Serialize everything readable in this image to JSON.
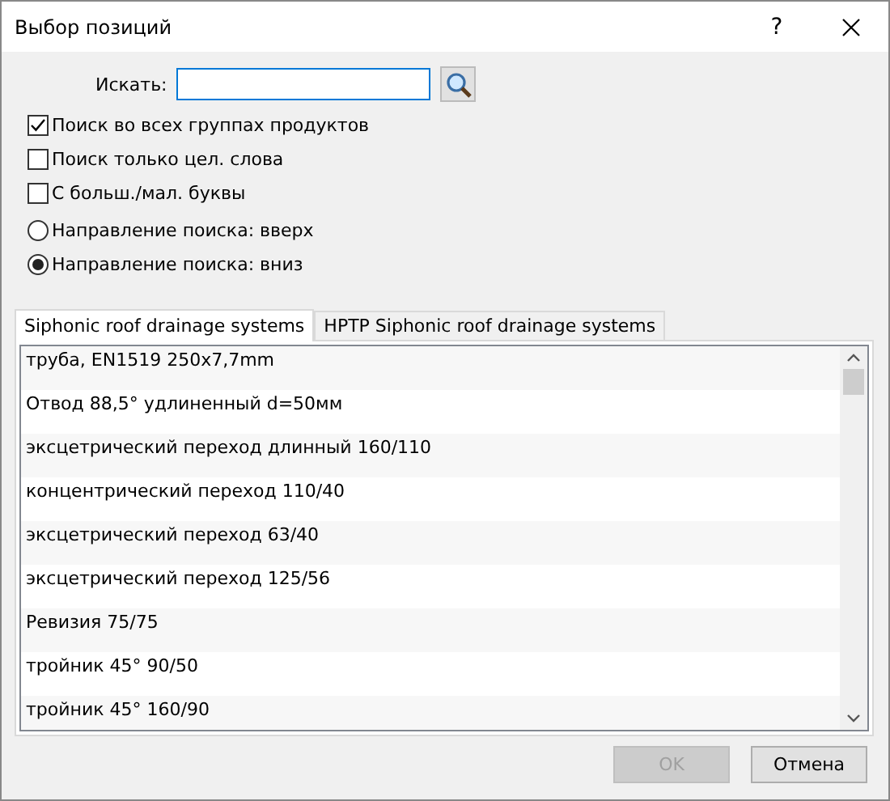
{
  "window": {
    "title": "Выбор позиций",
    "help": "?"
  },
  "search": {
    "label": "Искать:"
  },
  "options": [
    {
      "kind": "checkbox",
      "label": "Поиск во всех группах продуктов",
      "checked": true
    },
    {
      "kind": "checkbox",
      "label": "Поиск только цел. слова",
      "checked": false
    },
    {
      "kind": "checkbox",
      "label": "С больш./мал. буквы",
      "checked": false
    },
    {
      "kind": "radio",
      "label": "Направление поиска: вверх",
      "selected": false
    },
    {
      "kind": "radio",
      "label": "Направление поиска: вниз",
      "selected": true
    }
  ],
  "tabs": [
    {
      "label": "Siphonic roof drainage systems",
      "selected": true
    },
    {
      "label": "HPTP Siphonic roof drainage systems",
      "selected": false
    }
  ],
  "items": [
    "труба, EN1519 250x7,7mm",
    "Отвод 88,5° удлиненный d=50мм",
    "эксцетрический переход длинный 160/110",
    "концентрический переход 110/40",
    "эксцетрический переход 63/40",
    "эксцетрический переход 125/56",
    "Ревизия 75/75",
    "тройник 45° 90/50",
    "тройник 45° 160/90"
  ],
  "buttons": [
    {
      "label": "OK",
      "disabled": true
    },
    {
      "label": "Отмена",
      "disabled": false
    }
  ]
}
